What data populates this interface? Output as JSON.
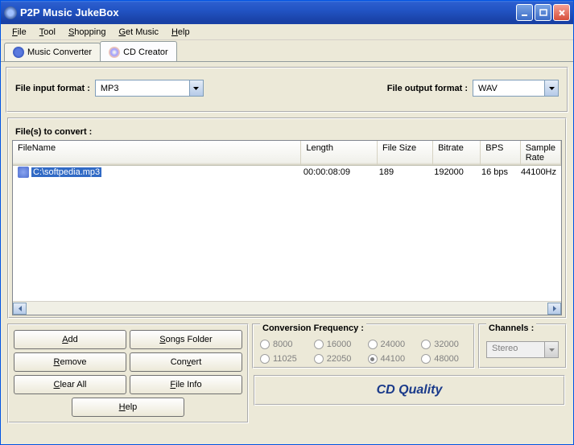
{
  "window": {
    "title": "P2P Music JukeBox"
  },
  "menu": {
    "file": "File",
    "tool": "Tool",
    "shopping": "Shopping",
    "getMusic": "Get Music",
    "help": "Help"
  },
  "tabs": {
    "converter": "Music Converter",
    "cdCreator": "CD Creator"
  },
  "format": {
    "inputLabel": "File input format :",
    "inputValue": "MP3",
    "outputLabel": "File output format :",
    "outputValue": "WAV"
  },
  "table": {
    "title": "File(s) to convert :",
    "headers": {
      "filename": "FileName",
      "length": "Length",
      "filesize": "File Size",
      "bitrate": "Bitrate",
      "bps": "BPS",
      "samplerate": "Sample Rate"
    },
    "rows": [
      {
        "filename": "C:\\softpedia.mp3",
        "length": "00:00:08:09",
        "filesize": "189",
        "bitrate": "192000",
        "bps": "16 bps",
        "samplerate": "44100Hz"
      }
    ]
  },
  "buttons": {
    "add": "Add",
    "songsFolder": "Songs Folder",
    "remove": "Remove",
    "convert": "Convert",
    "clearAll": "Clear All",
    "fileInfo": "File Info",
    "help": "Help"
  },
  "frequency": {
    "title": "Conversion Frequency :",
    "options": [
      "8000",
      "16000",
      "24000",
      "32000",
      "11025",
      "22050",
      "44100",
      "48000"
    ],
    "selected": "44100"
  },
  "channels": {
    "title": "Channels :",
    "value": "Stereo"
  },
  "quality": "CD Quality"
}
